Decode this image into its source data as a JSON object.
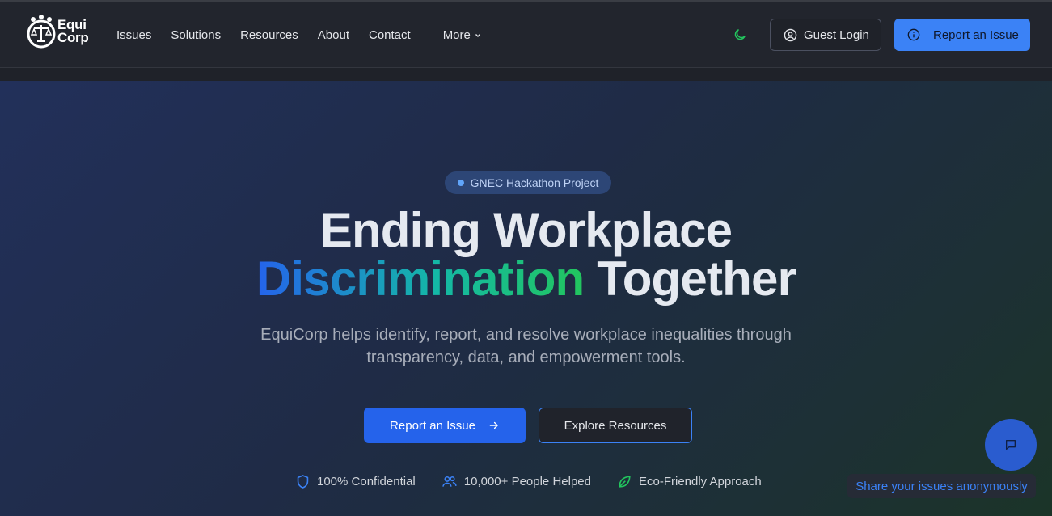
{
  "brand": {
    "line1": "Equi",
    "line2": "Corp"
  },
  "nav": {
    "items": [
      "Issues",
      "Solutions",
      "Resources",
      "About",
      "Contact"
    ],
    "more_label": "More"
  },
  "header_actions": {
    "theme_icon": "moon-icon",
    "guest_login": "Guest Login",
    "report_issue": "Report an Issue"
  },
  "hero": {
    "badge": "GNEC Hackathon Project",
    "title_line1": "Ending Workplace",
    "title_highlight": "Discrimination",
    "title_rest": "Together",
    "subtitle": "EquiCorp helps identify, report, and resolve workplace inequalities through transparency, data, and empowerment tools.",
    "primary_cta": "Report an Issue",
    "secondary_cta": "Explore Resources",
    "features": [
      {
        "icon": "shield-icon",
        "label": "100% Confidential"
      },
      {
        "icon": "users-icon",
        "label": "10,000+ People Helped"
      },
      {
        "icon": "leaf-icon",
        "label": "Eco-Friendly Approach"
      }
    ]
  },
  "chat": {
    "icon": "chat-icon",
    "tooltip": "Share your issues anonymously"
  },
  "colors": {
    "accent": "#3b82f6",
    "primary": "#2563eb",
    "green": "#22c55e"
  }
}
